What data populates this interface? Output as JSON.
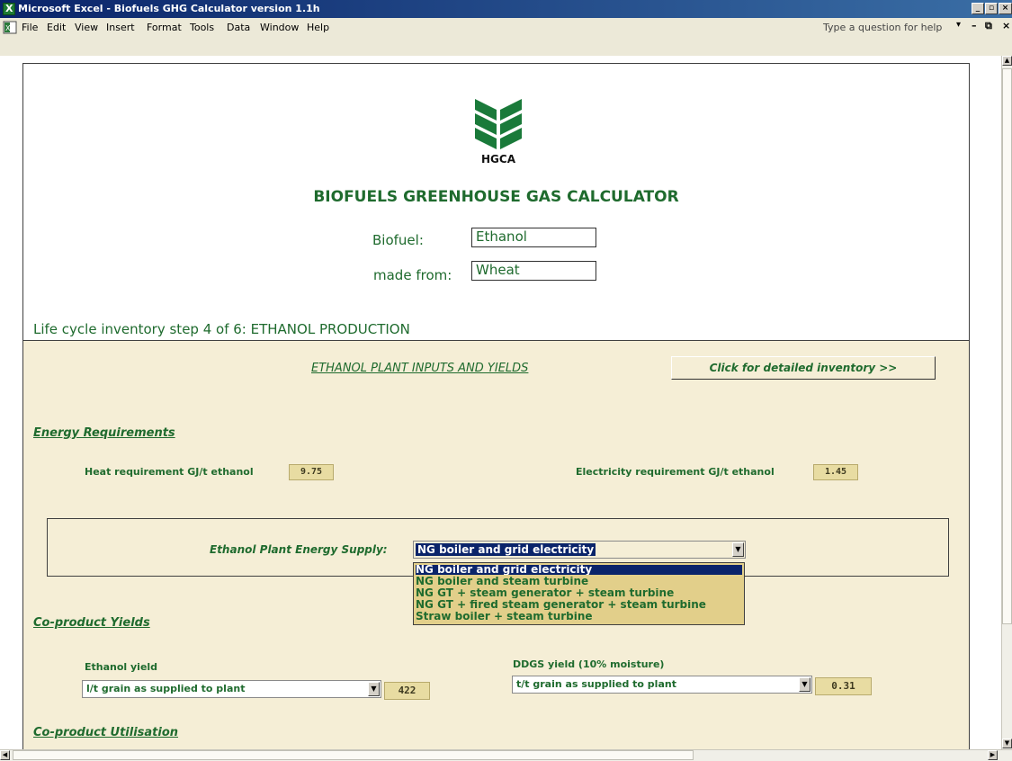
{
  "window": {
    "title": "Microsoft Excel - Biofuels GHG Calculator version 1.1h"
  },
  "menu": {
    "items": [
      "File",
      "Edit",
      "View",
      "Insert",
      "Format",
      "Tools",
      "Data",
      "Window",
      "Help"
    ],
    "ask_placeholder": "Type a question for help"
  },
  "header": {
    "logo_text": "HGCA",
    "title": "BIOFUELS GREENHOUSE GAS CALCULATOR",
    "biofuel_label": "Biofuel:",
    "biofuel_value": "Ethanol",
    "made_from_label": "made from:",
    "made_from_value": "Wheat",
    "step_text": "Life cycle inventory step 4 of 6: ETHANOL PRODUCTION"
  },
  "plant": {
    "heading": "ETHANOL PLANT INPUTS AND YIELDS",
    "detail_button": "Click for detailed inventory >>"
  },
  "energy": {
    "section": "Energy Requirements",
    "heat_label": "Heat requirement GJ/t ethanol",
    "heat_value": "9.75",
    "elec_label": "Electricity requirement GJ/t ethanol",
    "elec_value": "1.45"
  },
  "supply": {
    "label": "Ethanol Plant Energy Supply:",
    "selected": "NG boiler and grid electricity",
    "options": [
      "NG boiler and grid electricity",
      "NG boiler and steam turbine",
      "NG GT + steam generator + steam turbine",
      "NG GT + fired steam generator + steam turbine",
      "Straw boiler + steam turbine"
    ]
  },
  "yields": {
    "section": "Co-product Yields",
    "ethanol_label": "Ethanol yield",
    "ethanol_unit": "l/t grain as supplied to plant",
    "ethanol_value": "422",
    "ddgs_label": "DDGS yield (10% moisture)",
    "ddgs_unit": "t/t grain as supplied to plant",
    "ddgs_value": "0.31"
  },
  "utilisation": {
    "section": "Co-product Utilisation"
  },
  "colors": {
    "text_green": "#1f6b2e",
    "panel_beige": "#f5eed6",
    "select_blue": "#0a246a",
    "value_tan": "#e8dca2"
  }
}
